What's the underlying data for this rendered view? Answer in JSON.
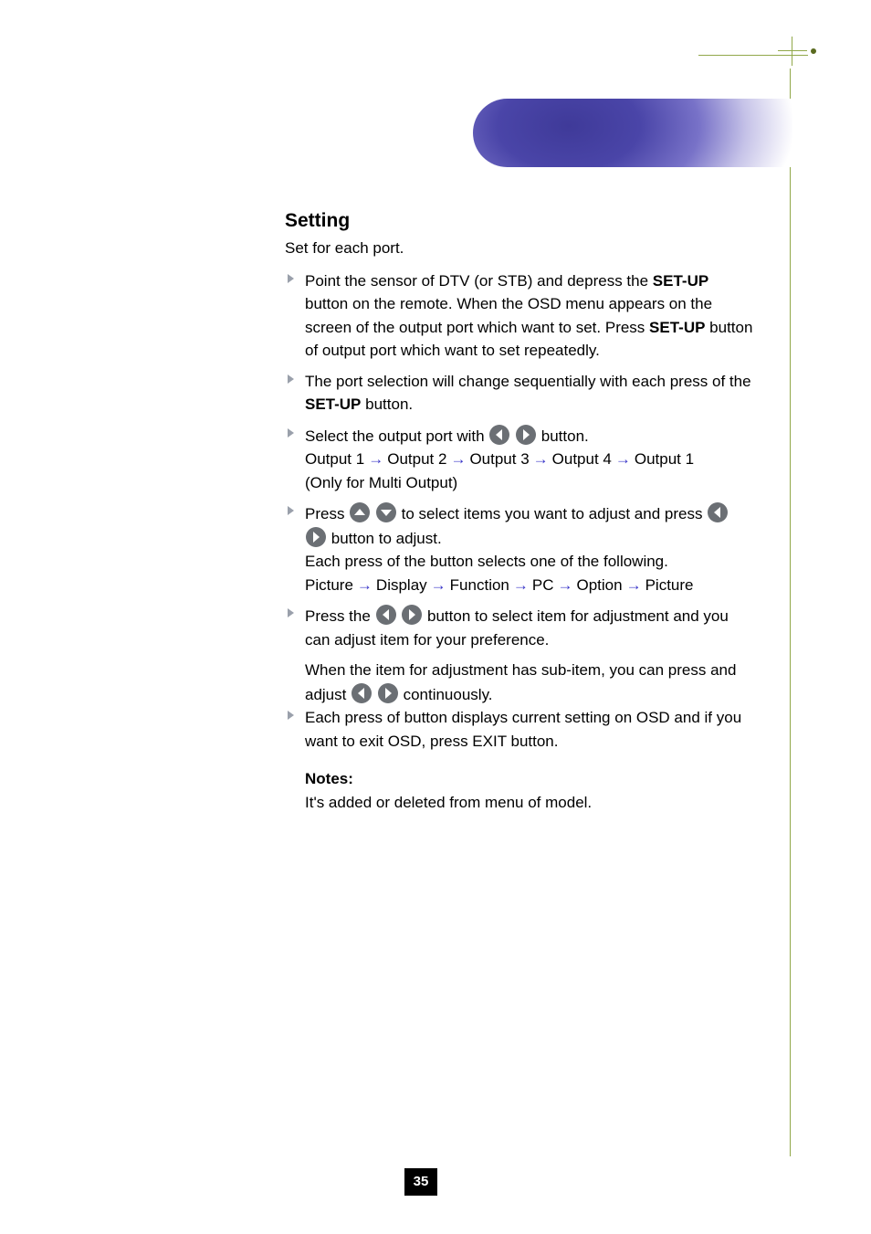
{
  "section": {
    "title": "Setting",
    "desc": "Set for each port."
  },
  "steps": {
    "s1": {
      "text_a": "Point the sensor of DTV (or STB) and depress the ",
      "bold_a": "SET-UP",
      "text_b": " button on the remote. When the OSD menu appears on the screen of the output port which want to set. Press ",
      "bold_b": "SET-UP",
      "text_c": " button of output port which want to set repeatedly."
    },
    "s2": {
      "text_a": "The port selection will change sequentially with each press of the ",
      "bold_a": "SET-UP",
      "text_b": " button."
    },
    "s3": {
      "text_a": "Select the output port with ",
      "text_b": " button.",
      "seq": [
        "Output 1",
        "Output 2",
        "Output 3",
        "Output 4",
        "Output 1"
      ],
      "note": "(Only for Multi Output)"
    },
    "s4": {
      "text_a": "Press ",
      "text_b": " to select items you want to adjust and press ",
      "text_c": " button to adjust.",
      "text_d": "Each press of the button selects one of the following.",
      "seq": [
        "Picture",
        "Display",
        "Function",
        "PC",
        "Option",
        "Picture"
      ]
    },
    "s5": {
      "text_a": "Press the ",
      "text_b": " button to select item for adjustment and you can adjust item for your preference.",
      "text_c": "When the item for adjustment has sub-item, you can press and adjust ",
      "text_d": " continuously."
    },
    "s6": "Each press of button displays current setting on OSD and if you want to exit OSD, press EXIT button.",
    "note_text": "It's added or deleted from menu of model."
  },
  "note_label": "Notes:",
  "page_number": "35"
}
